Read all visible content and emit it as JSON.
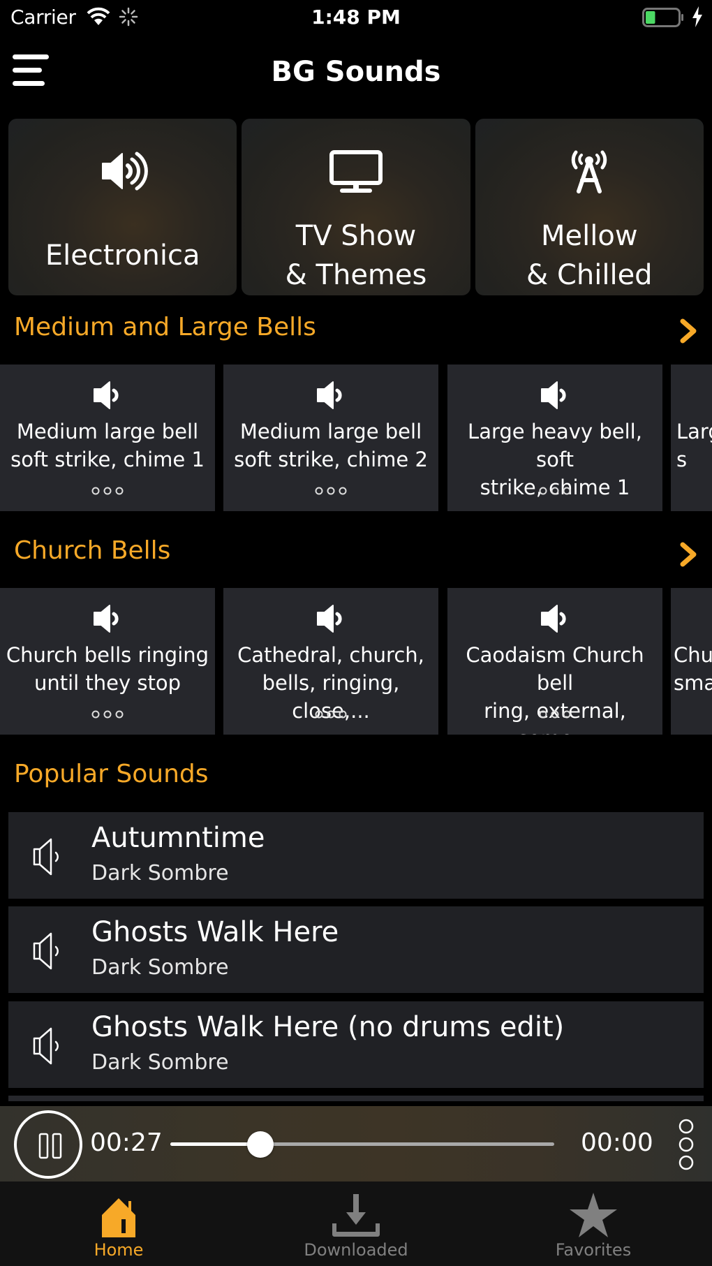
{
  "status_bar": {
    "carrier": "Carrier",
    "time": "1:48 PM",
    "battery_level": 0.3,
    "charging": true,
    "icons": [
      "wifi-icon",
      "activity-spinner-icon",
      "battery-icon",
      "charging-bolt-icon"
    ]
  },
  "nav": {
    "title": "BG Sounds",
    "menu_icon": "hamburger-menu-icon"
  },
  "colors": {
    "accent": "#f7a928",
    "card_bg": "#26272c",
    "list_bg": "#202125",
    "tab_inactive": "#808080"
  },
  "genres": [
    {
      "label_line1": "Electronica",
      "label_line2": "",
      "icon": "speaker-loud-icon"
    },
    {
      "label_line1": "TV Show",
      "label_line2": "& Themes",
      "icon": "monitor-icon"
    },
    {
      "label_line1": "Mellow",
      "label_line2": "& Chilled",
      "icon": "radio-antenna-icon"
    }
  ],
  "sections": [
    {
      "title": "Medium and Large Bells",
      "more_icon": "chevron-right-icon",
      "cards": [
        {
          "text": "Medium large bell\nsoft strike, chime 1",
          "icon": "speaker-icon"
        },
        {
          "text": "Medium large bell\nsoft strike, chime 2",
          "icon": "speaker-icon"
        },
        {
          "text": "Large heavy bell, soft\nstrike, chime 1",
          "icon": "speaker-icon"
        },
        {
          "text": "Larg\ns",
          "icon": "speaker-icon"
        }
      ]
    },
    {
      "title": "Church Bells",
      "more_icon": "chevron-right-icon",
      "cards": [
        {
          "text": "Church bells ringing\nuntil they stop",
          "icon": "speaker-icon"
        },
        {
          "text": "Cathedral, church,\nbells, ringing, close,...",
          "icon": "speaker-icon"
        },
        {
          "text": "Caodaism Church bell\nring, external, some...",
          "icon": "speaker-icon"
        },
        {
          "text": "Chu\nsma",
          "icon": "speaker-icon"
        }
      ]
    }
  ],
  "popular": {
    "title": "Popular Sounds",
    "items": [
      {
        "title": "Autumntime",
        "subtitle": "Dark Sombre",
        "icon": "speaker-outline-icon"
      },
      {
        "title": "Ghosts Walk Here",
        "subtitle": "Dark Sombre",
        "icon": "speaker-outline-icon"
      },
      {
        "title": "Ghosts Walk Here (no drums edit)",
        "subtitle": "Dark Sombre",
        "icon": "speaker-outline-icon"
      }
    ]
  },
  "player": {
    "elapsed": "00:27",
    "total": "00:00",
    "progress": 0.235,
    "state": "playing",
    "pause_icon": "pause-icon",
    "more_icon": "more-vertical-icon"
  },
  "tabs": [
    {
      "label": "Home",
      "icon": "home-icon",
      "active": true
    },
    {
      "label": "Downloaded",
      "icon": "download-icon",
      "active": false
    },
    {
      "label": "Favorites",
      "icon": "star-icon",
      "active": false
    }
  ]
}
